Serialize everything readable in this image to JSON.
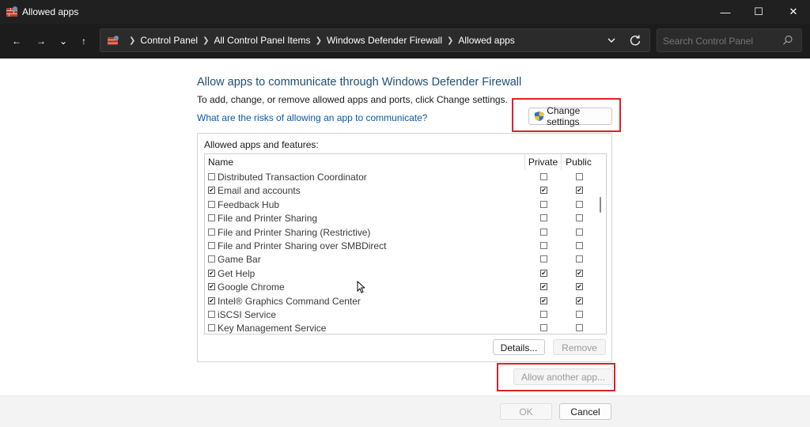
{
  "window": {
    "title": "Allowed apps",
    "minimize_glyph": "—",
    "maximize_glyph": "☐",
    "close_glyph": "✕"
  },
  "nav": {
    "back_glyph": "←",
    "forward_glyph": "→",
    "recent_glyph": "⌄",
    "up_glyph": "↑",
    "breadcrumb": [
      "Control Panel",
      "All Control Panel Items",
      "Windows Defender Firewall",
      "Allowed apps"
    ],
    "search_placeholder": "Search Control Panel"
  },
  "main": {
    "heading": "Allow apps to communicate through Windows Defender Firewall",
    "subtext": "To add, change, or remove allowed apps and ports, click Change settings.",
    "risk_link": "What are the risks of allowing an app to communicate?",
    "change_settings_label": "Change settings",
    "group_label": "Allowed apps and features:",
    "columns": {
      "name": "Name",
      "private": "Private",
      "public": "Public"
    },
    "apps": [
      {
        "name": "Distributed Transaction Coordinator",
        "enabled": false,
        "private": false,
        "public": false
      },
      {
        "name": "Email and accounts",
        "enabled": true,
        "private": true,
        "public": true
      },
      {
        "name": "Feedback Hub",
        "enabled": false,
        "private": false,
        "public": false
      },
      {
        "name": "File and Printer Sharing",
        "enabled": false,
        "private": false,
        "public": false
      },
      {
        "name": "File and Printer Sharing (Restrictive)",
        "enabled": false,
        "private": false,
        "public": false
      },
      {
        "name": "File and Printer Sharing over SMBDirect",
        "enabled": false,
        "private": false,
        "public": false
      },
      {
        "name": "Game Bar",
        "enabled": false,
        "private": false,
        "public": false
      },
      {
        "name": "Get Help",
        "enabled": true,
        "private": true,
        "public": true
      },
      {
        "name": "Google Chrome",
        "enabled": true,
        "private": true,
        "public": true
      },
      {
        "name": "Intel® Graphics Command Center",
        "enabled": true,
        "private": true,
        "public": true
      },
      {
        "name": "iSCSI Service",
        "enabled": false,
        "private": false,
        "public": false
      },
      {
        "name": "Key Management Service",
        "enabled": false,
        "private": false,
        "public": false
      }
    ],
    "details_label": "Details...",
    "remove_label": "Remove",
    "allow_another_label": "Allow another app..."
  },
  "footer": {
    "ok_label": "OK",
    "cancel_label": "Cancel"
  },
  "colors": {
    "titlebar": "#202020",
    "heading": "#1f4e79",
    "link": "#0a5aa6",
    "highlight": "#d9232a"
  }
}
